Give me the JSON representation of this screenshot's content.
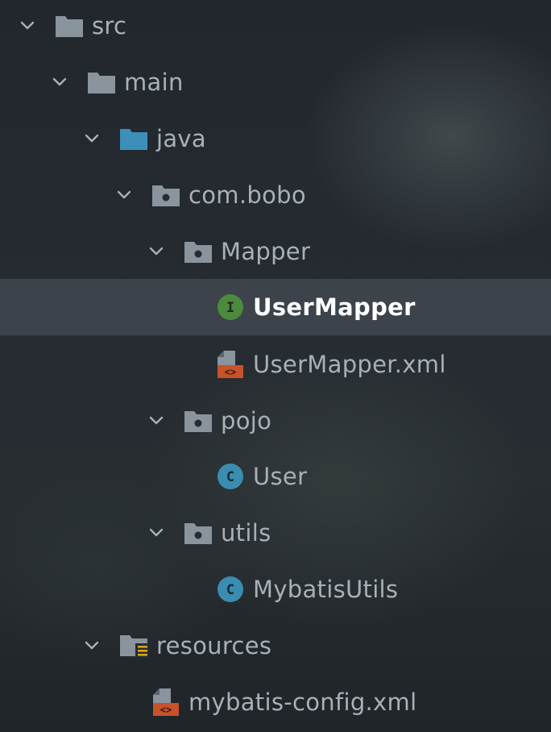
{
  "project_tree": {
    "items": [
      {
        "label": "src",
        "icon": "folder-icon",
        "expanded": true,
        "level": 0
      },
      {
        "label": "main",
        "icon": "folder-icon",
        "expanded": true,
        "level": 1
      },
      {
        "label": "java",
        "icon": "source-folder-icon",
        "expanded": true,
        "level": 2
      },
      {
        "label": "com.bobo",
        "icon": "package-icon",
        "expanded": true,
        "level": 3
      },
      {
        "label": "Mapper",
        "icon": "package-icon",
        "expanded": true,
        "level": 4
      },
      {
        "label": "UserMapper",
        "icon": "interface-icon",
        "icon_letter": "I",
        "selected": true,
        "level": 5
      },
      {
        "label": "UserMapper.xml",
        "icon": "xml-file-icon",
        "icon_glyph": "<>",
        "level": 5
      },
      {
        "label": "pojo",
        "icon": "package-icon",
        "expanded": true,
        "level": 4
      },
      {
        "label": "User",
        "icon": "class-icon",
        "icon_letter": "C",
        "level": 5
      },
      {
        "label": "utils",
        "icon": "package-icon",
        "expanded": true,
        "level": 4
      },
      {
        "label": "MybatisUtils",
        "icon": "class-icon",
        "icon_letter": "C",
        "level": 5
      },
      {
        "label": "resources",
        "icon": "resources-folder-icon",
        "expanded": true,
        "level": 2
      },
      {
        "label": "mybatis-config.xml",
        "icon": "xml-file-icon",
        "icon_glyph": "<>",
        "level": 3
      }
    ]
  },
  "colors": {
    "folder": "#8a949d",
    "source_folder": "#3c8fb8",
    "interface": "#4e8a3e",
    "class": "#3a8db0",
    "xml": "#c8522a",
    "label": "#a8b0b8",
    "selected_label": "#ffffff",
    "selected_row": "#3f464d"
  }
}
